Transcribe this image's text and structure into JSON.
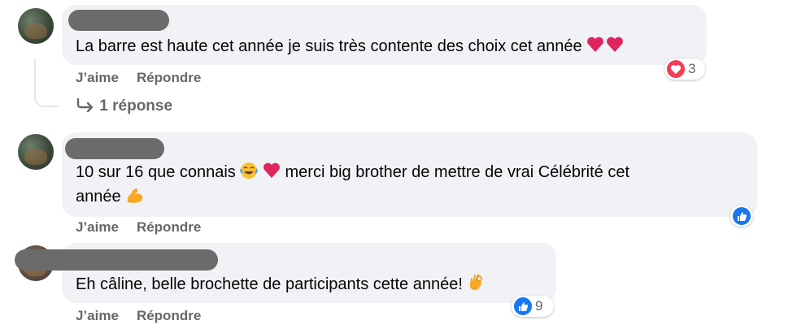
{
  "comments": [
    {
      "text": "La barre est haute cet année je suis très contente des choix cet année",
      "actions": {
        "like": "J’aime",
        "reply": "Répondre"
      },
      "reaction_count": "3",
      "reaction_type": "love",
      "replies_link": "1 réponse"
    },
    {
      "text_line1": "10 sur 16 que connais",
      "text_line1b": "merci big brother de mettre de vrai Célébrité cet",
      "text_line2": "année",
      "actions": {
        "like": "J’aime",
        "reply": "Répondre"
      },
      "reaction_type": "like"
    },
    {
      "text": "Eh câline, belle brochette de participants cette année!",
      "actions": {
        "like": "J’aime",
        "reply": "Répondre"
      },
      "reaction_count": "9",
      "reaction_type": "like"
    }
  ],
  "icons": {
    "heart": "red-heart-icon",
    "laugh": "tears-of-joy-icon",
    "muscle": "flexed-biceps-icon",
    "ok": "ok-hand-icon",
    "love_reaction": "love-reaction-icon",
    "like_reaction": "like-reaction-icon",
    "reply_arrow": "reply-arrow-icon"
  },
  "colors": {
    "bubble": "#f0f2f5",
    "meta": "#65676b",
    "like": "#1877f2",
    "love": "#f33e58"
  }
}
